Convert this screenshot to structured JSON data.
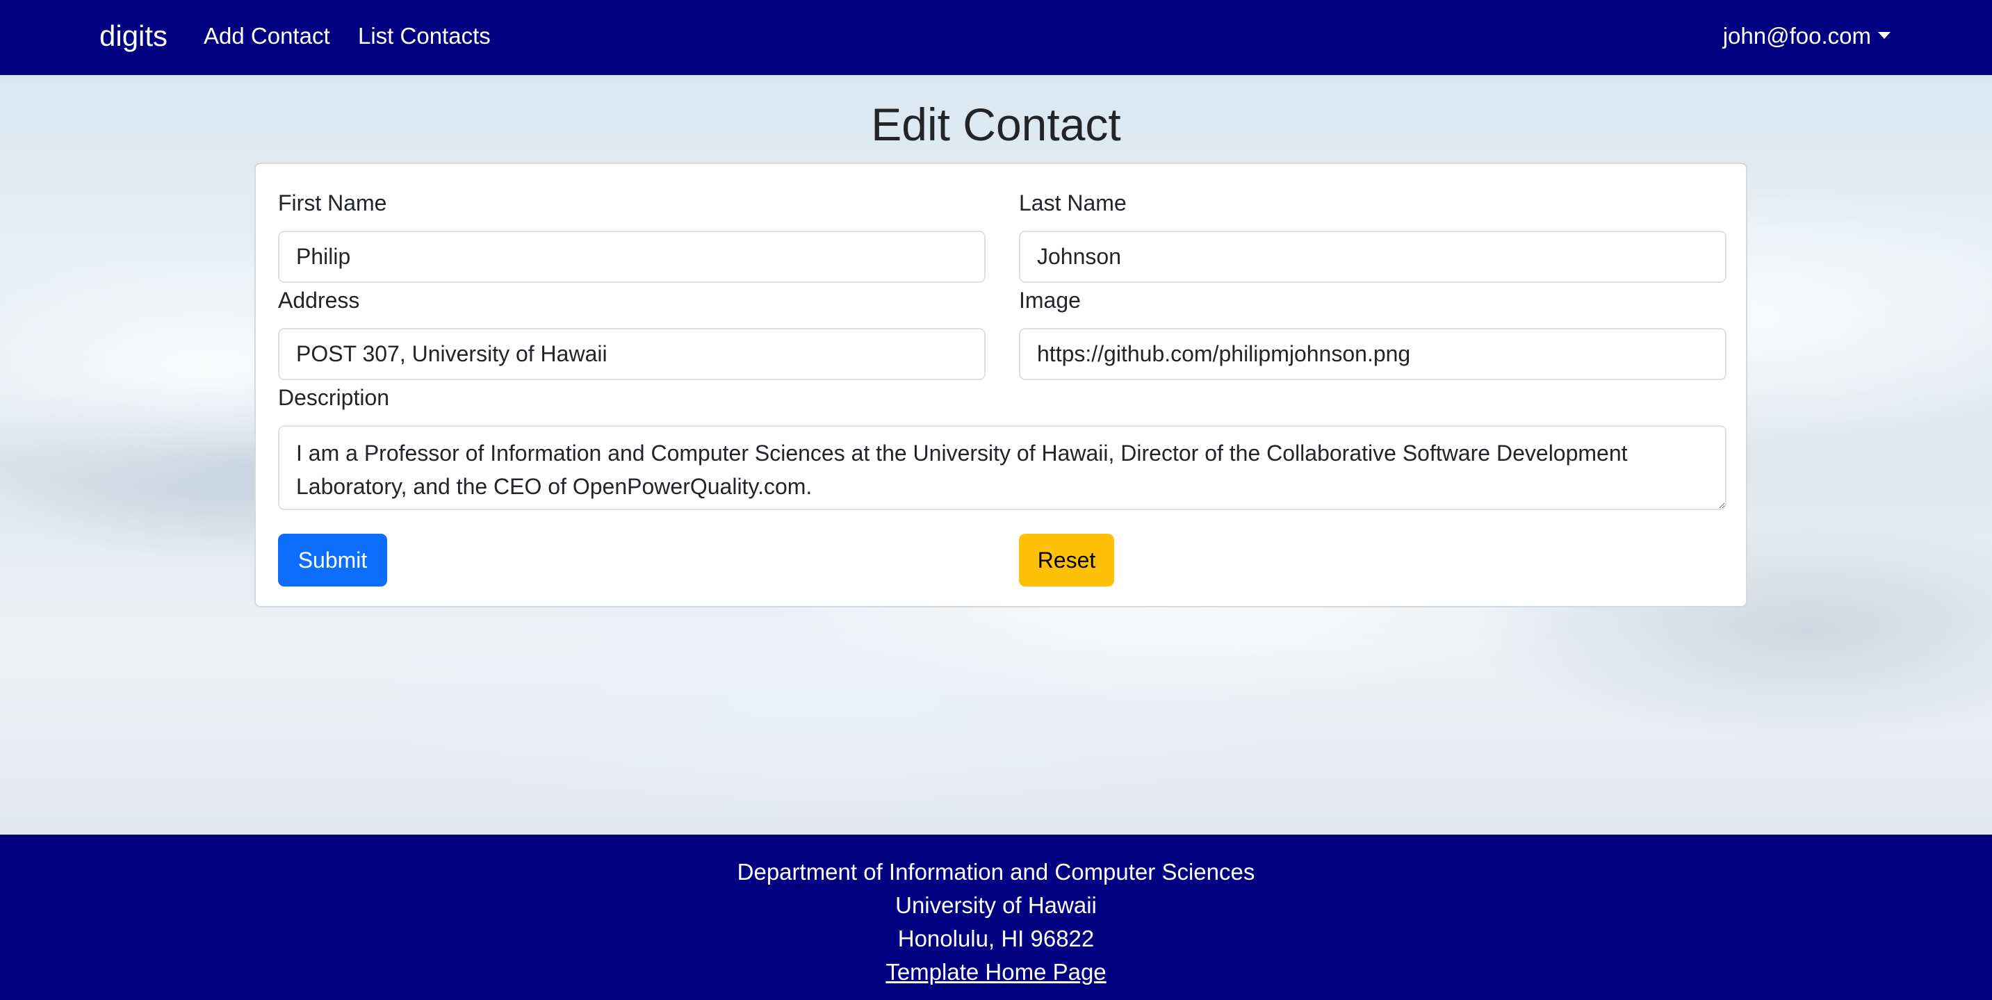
{
  "navbar": {
    "brand": "digits",
    "links": [
      "Add Contact",
      "List Contacts"
    ],
    "user": "john@foo.com"
  },
  "page": {
    "title": "Edit Contact"
  },
  "form": {
    "first_name": {
      "label": "First Name",
      "value": "Philip"
    },
    "last_name": {
      "label": "Last Name",
      "value": "Johnson"
    },
    "address": {
      "label": "Address",
      "value": "POST 307, University of Hawaii"
    },
    "image": {
      "label": "Image",
      "value": "https://github.com/philipmjohnson.png"
    },
    "description": {
      "label": "Description",
      "value": "I am a Professor of Information and Computer Sciences at the University of Hawaii, Director of the Collaborative Software Development Laboratory, and the CEO of OpenPowerQuality.com."
    },
    "submit_label": "Submit",
    "reset_label": "Reset"
  },
  "footer": {
    "lines": [
      "Department of Information and Computer Sciences",
      "University of Hawaii",
      "Honolulu, HI 96822"
    ],
    "link": "Template Home Page"
  },
  "colors": {
    "navbar": "#000080",
    "primary": "#0d6efd",
    "warning": "#ffc107"
  }
}
